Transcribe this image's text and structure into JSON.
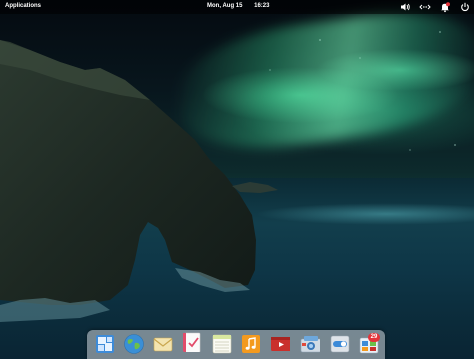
{
  "top_panel": {
    "applications_label": "Applications",
    "date": "Mon, Aug 15",
    "time": "16:23"
  },
  "tray": [
    {
      "name": "volume-icon"
    },
    {
      "name": "network-icon"
    },
    {
      "name": "notifications-icon"
    },
    {
      "name": "power-icon"
    }
  ],
  "dock": {
    "apps": [
      {
        "name": "multitasking-view"
      },
      {
        "name": "web-browser"
      },
      {
        "name": "mail"
      },
      {
        "name": "tasks"
      },
      {
        "name": "calendar"
      },
      {
        "name": "music"
      },
      {
        "name": "videos"
      },
      {
        "name": "photos"
      },
      {
        "name": "system-settings"
      },
      {
        "name": "app-center"
      }
    ],
    "app_center_badge": "29"
  },
  "colors": {
    "panel_bg": "#000000",
    "dock_bg": "#d2d7dc",
    "badge": "#e4343a",
    "notification_dot": "#e4343a"
  }
}
